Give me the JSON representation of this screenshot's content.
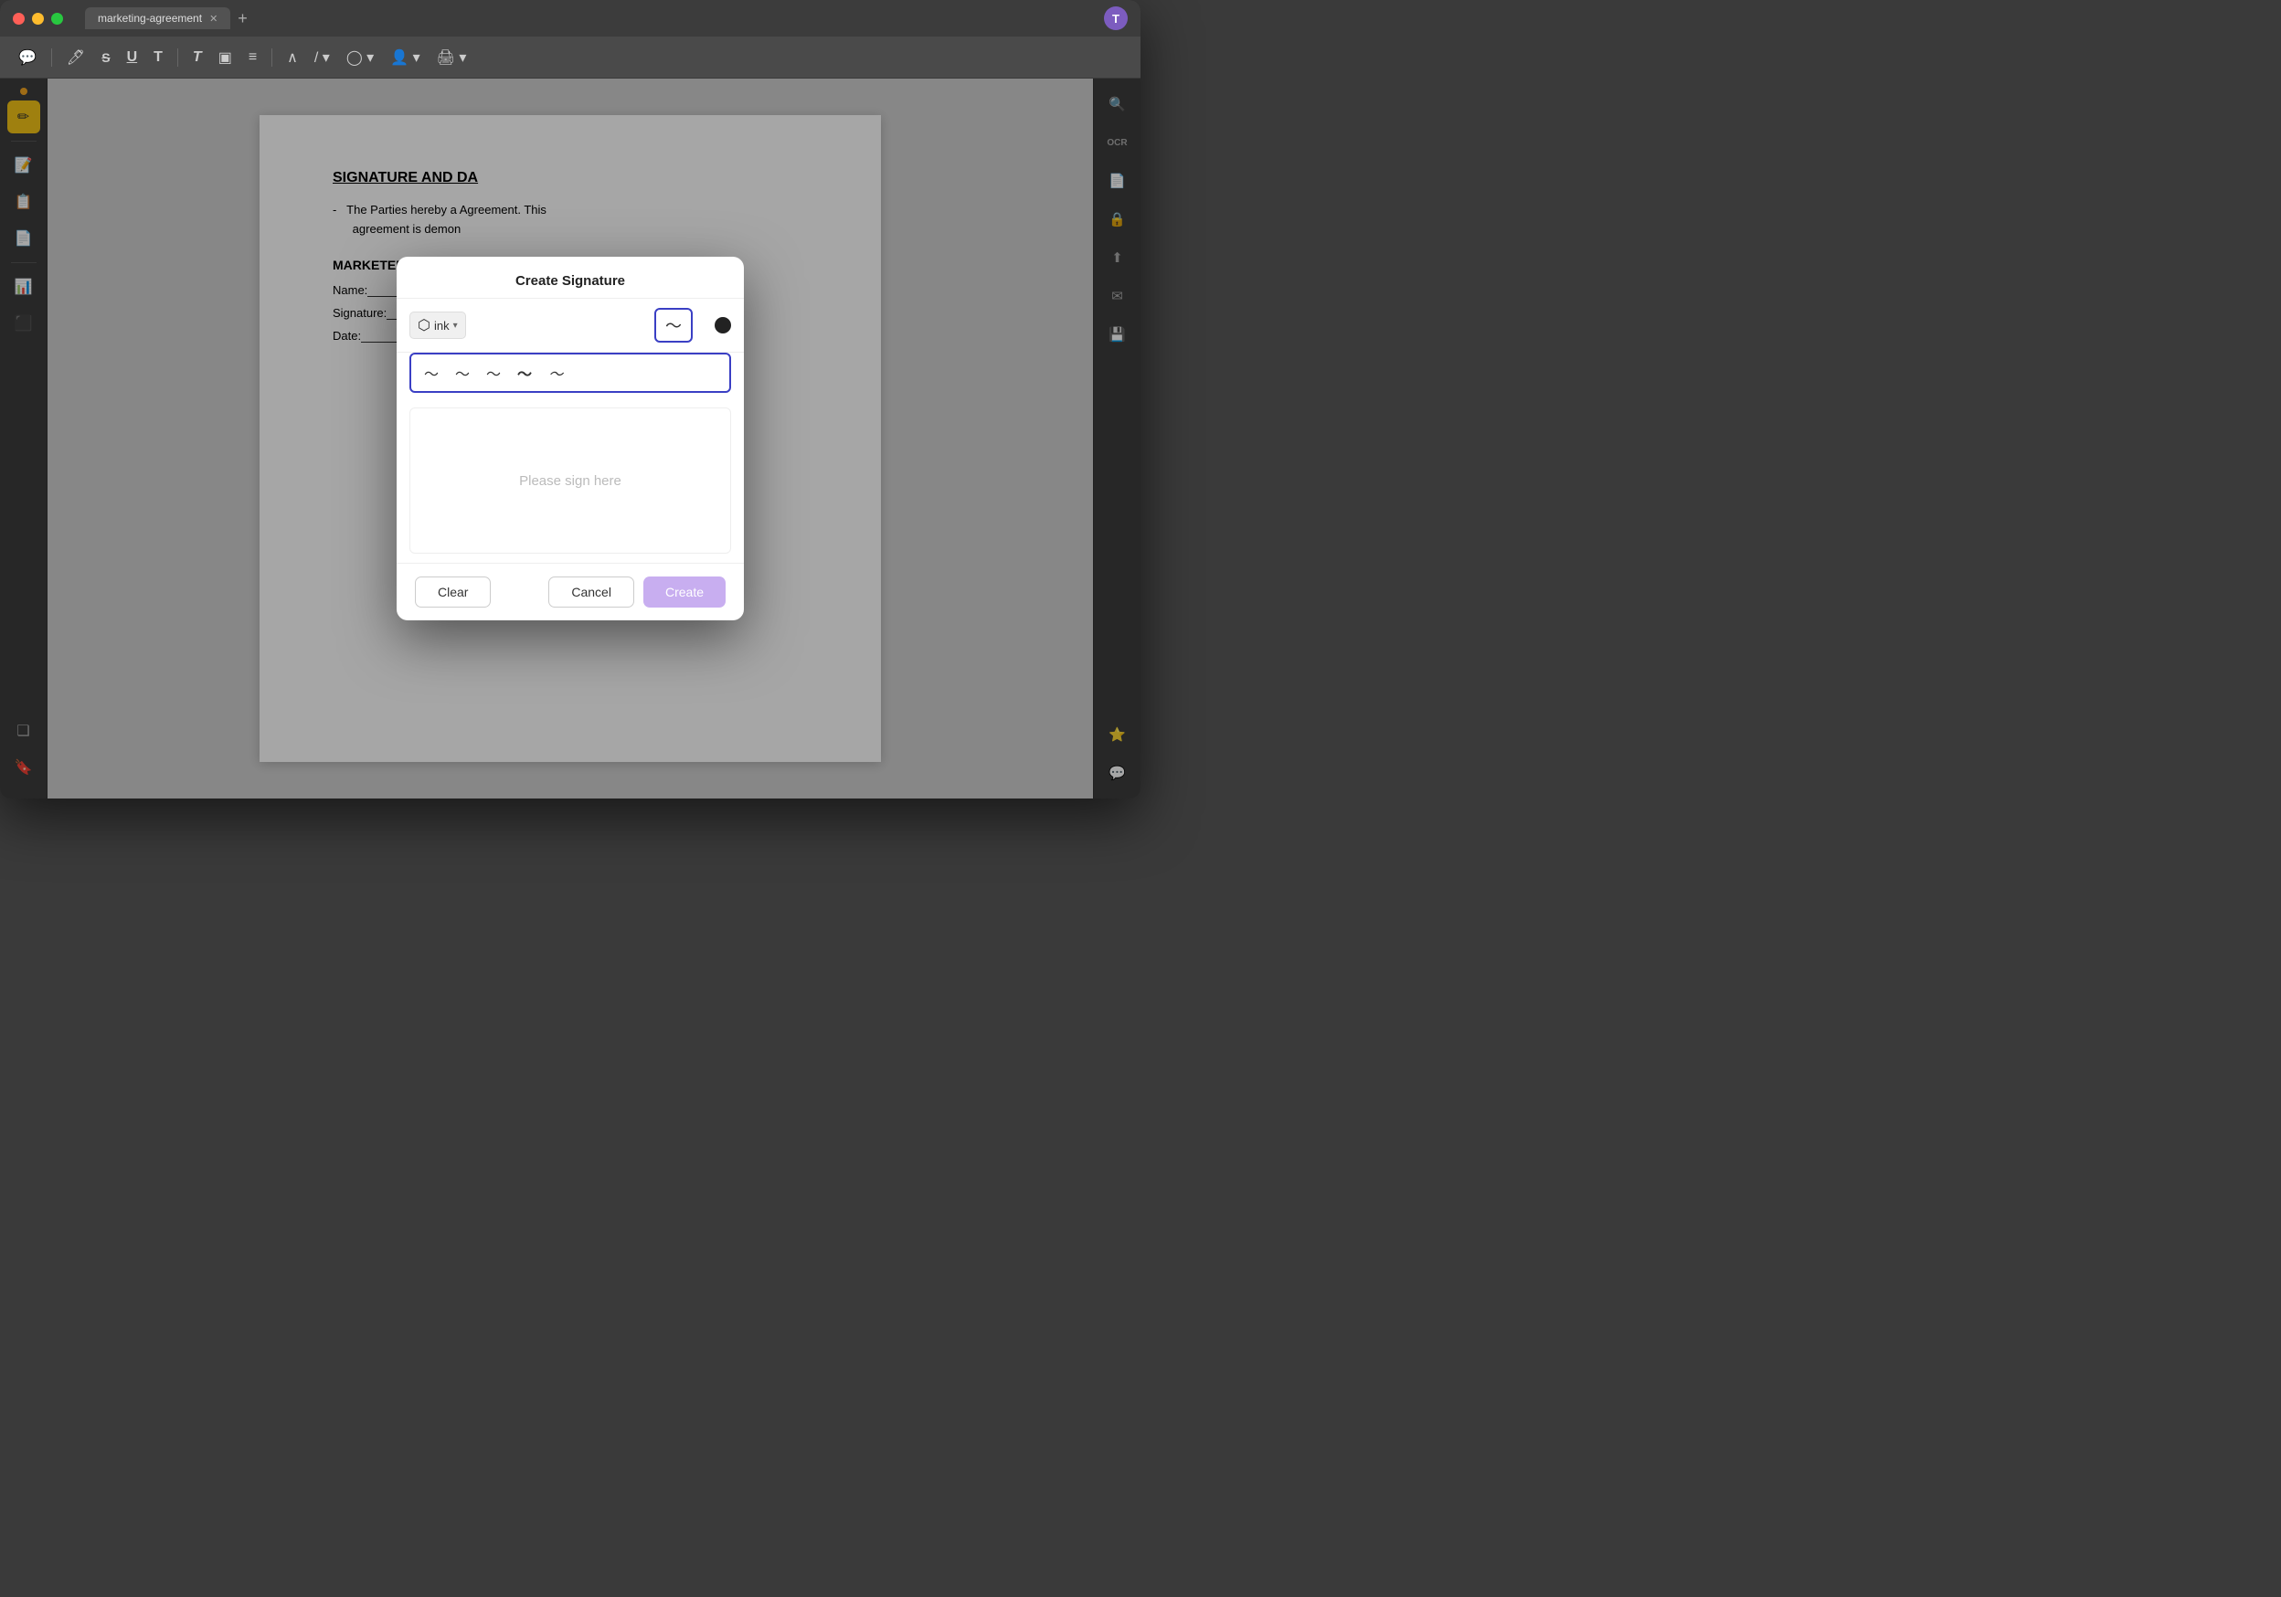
{
  "window": {
    "title": "marketing-agreement",
    "tab_label": "marketing-agreement"
  },
  "user_avatar": "T",
  "toolbar": {
    "buttons": [
      "💬",
      "🖊",
      "S",
      "U",
      "T",
      "T",
      "▣",
      "≡",
      "∧",
      "/▾",
      "◎▾",
      "👤▾",
      "🖨▾"
    ]
  },
  "dialog": {
    "title": "Create Signature",
    "ink_label": "ink",
    "ink_chevron": "▾",
    "pen_styles": [
      "〜",
      "〜",
      "〜",
      "〜",
      "〜"
    ],
    "placeholder": "Please sign here",
    "clear_label": "Clear",
    "cancel_label": "Cancel",
    "create_label": "Create"
  },
  "document": {
    "heading": "SIGNATURE AND DA",
    "party_text": "The Parties hereby a",
    "party_text2": "agreement is demon",
    "section_marketer": "MARKETER",
    "name_label": "Name:",
    "signature_label": "Signature:",
    "date_label": "Date:"
  },
  "sidebar_left": {
    "buttons": [
      "📄",
      "✏",
      "📝",
      "📋",
      "📊",
      "🔖"
    ]
  },
  "sidebar_right": {
    "buttons": [
      "🔍",
      "OCR",
      "📄",
      "🔒",
      "⬆",
      "✉",
      "💾",
      "⭐",
      "💬"
    ]
  }
}
